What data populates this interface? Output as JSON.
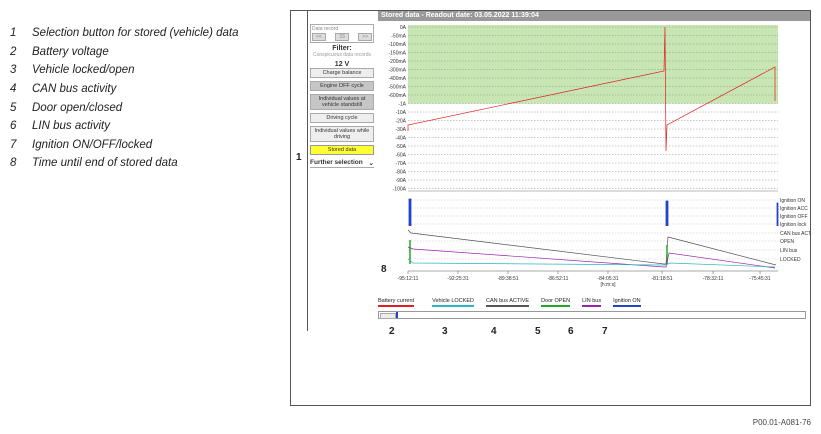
{
  "legend": [
    {
      "num": "1",
      "text": "Selection button for stored (vehicle) data"
    },
    {
      "num": "2",
      "text": "Battery voltage"
    },
    {
      "num": "3",
      "text": "Vehicle locked/open"
    },
    {
      "num": "4",
      "text": "CAN bus activity"
    },
    {
      "num": "5",
      "text": "Door open/closed"
    },
    {
      "num": "6",
      "text": "LIN bus activity"
    },
    {
      "num": "7",
      "text": "Ignition ON/OFF/locked"
    },
    {
      "num": "8",
      "text": "Time until end of stored data"
    }
  ],
  "panel": {
    "data_record_label": "Data record",
    "page_prev": "<<",
    "page_value": "33",
    "page_next": ">>",
    "filter_label": "Filter:",
    "conspicuous": "Conspicuous data records",
    "voltage": "12 V",
    "charge_balance": "Charge balance",
    "engine_off": "Engine OFF cycle",
    "individual_standstill": "Individual values at vehicle standstill",
    "driving_cycle": "Driving cycle",
    "individual_driving": "Individual values while driving",
    "stored_data": "Stored data",
    "further_selection": "Further selection",
    "further_arrow": "⌄"
  },
  "chart_header": "Stored data - Readout date: 03.05.2022 11:39:04",
  "chart_data": {
    "type": "line",
    "y_ticks": [
      "0A",
      "-50mA",
      "-100mA",
      "-150mA",
      "-200mA",
      "-300mA",
      "-400mA",
      "-500mA",
      "-600mA",
      "-1A",
      "-10A",
      "-20A",
      "-30A",
      "-40A",
      "-50A",
      "-60A",
      "-70A",
      "-80A",
      "-90A",
      "-100A"
    ],
    "x_ticks": [
      "-95:12:11",
      "-92:25:31",
      "-89:38:51",
      "-86:52:11",
      "-84:05:31",
      "-81:18:51",
      "-78:32:11",
      "-75:45:31"
    ],
    "x_unit": "[h:m:s]",
    "state_labels": [
      "Ignition ON",
      "Ignition ACC",
      "Ignition OFF",
      "Ignition lock",
      "CAN bus ACT",
      "OPEN",
      "LIN bus",
      "LOCKED"
    ],
    "colors": {
      "battery": "#e02020",
      "locked": "#2ab5c8",
      "can": "#555555",
      "door": "#22aa22",
      "lin": "#9922aa",
      "ignition": "#2244cc",
      "band": "#c8e6b4"
    }
  },
  "chart_legend": [
    {
      "label": "Battery current",
      "color": "#e02020"
    },
    {
      "label": "Vehicle LOCKED",
      "color": "#2ab5c8"
    },
    {
      "label": "CAN bus ACTIVE",
      "color": "#555555"
    },
    {
      "label": "Door OPEN",
      "color": "#22aa22"
    },
    {
      "label": "LIN bus",
      "color": "#9922aa"
    },
    {
      "label": "Ignition ON",
      "color": "#2244cc"
    }
  ],
  "callouts": {
    "c1": "1",
    "c2": "2",
    "c3": "3",
    "c4": "4",
    "c5": "5",
    "c6": "6",
    "c7": "7",
    "c8": "8"
  },
  "footer_code": "P00.01-A081-76"
}
